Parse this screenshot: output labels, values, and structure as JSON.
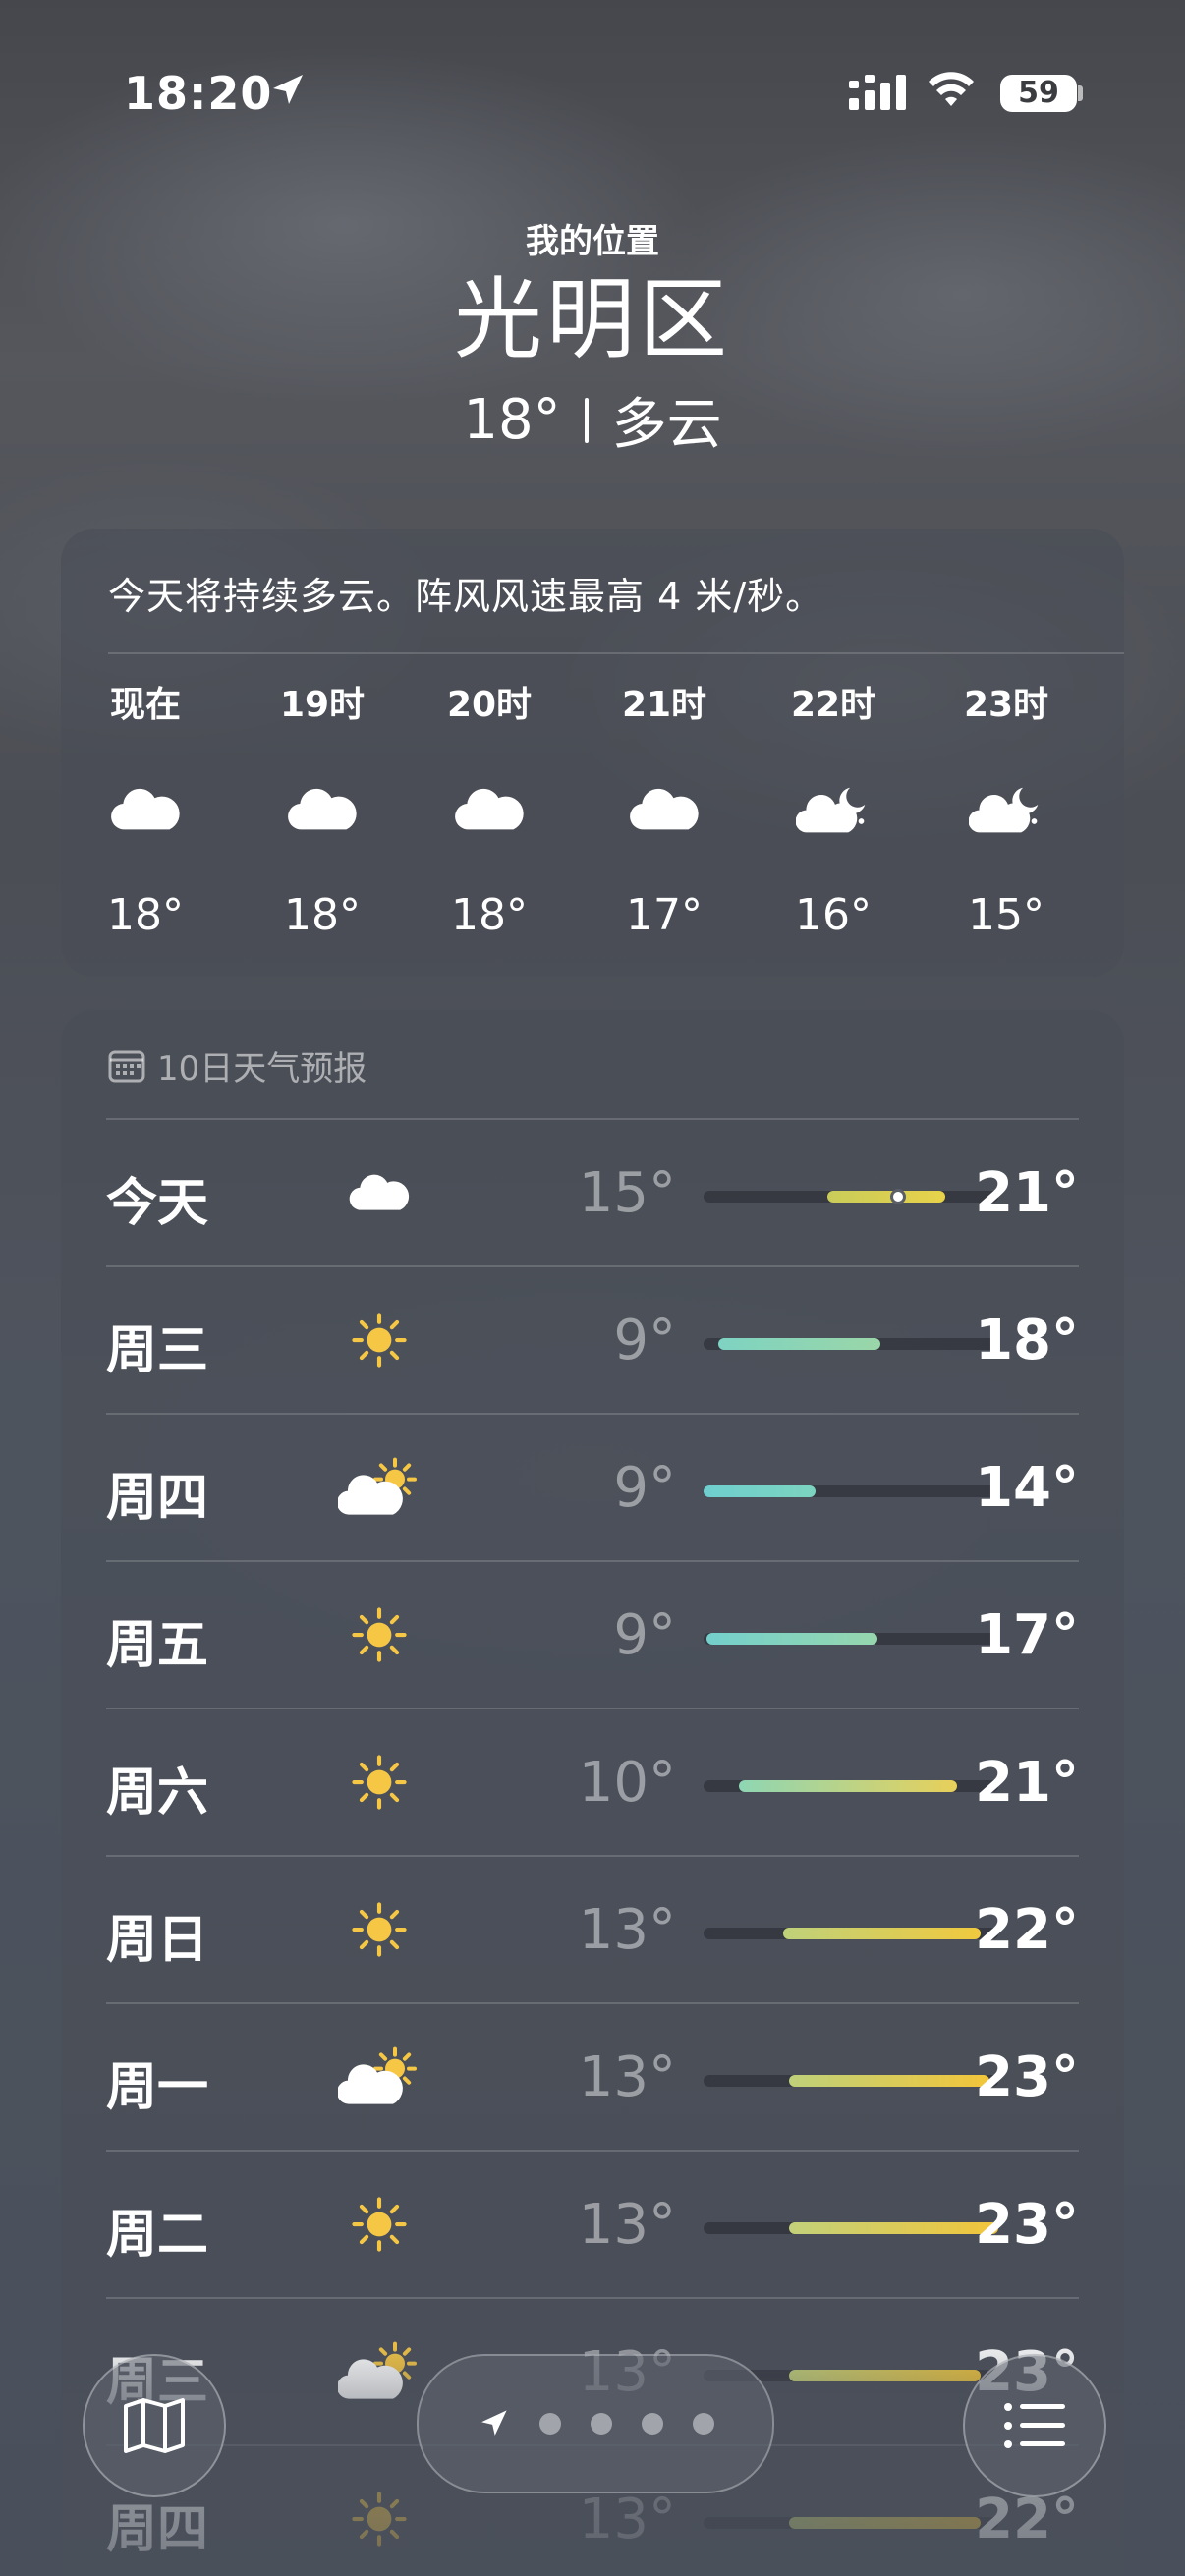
{
  "status_bar": {
    "time": "18:20",
    "battery": "59"
  },
  "header": {
    "my_location": "我的位置",
    "city": "光明区",
    "temperature": "18°",
    "condition": "多云"
  },
  "hourly": {
    "summary": "今天将持续多云。阵风风速最高 4 米/秒。",
    "items": [
      {
        "label": "现在",
        "icon": "cloud-icon",
        "temp": "18°"
      },
      {
        "label": "19时",
        "icon": "cloud-icon",
        "temp": "18°"
      },
      {
        "label": "20时",
        "icon": "cloud-icon",
        "temp": "18°"
      },
      {
        "label": "21时",
        "icon": "cloud-icon",
        "temp": "17°"
      },
      {
        "label": "22时",
        "icon": "cloud-moon-icon",
        "temp": "16°"
      },
      {
        "label": "23时",
        "icon": "cloud-moon-icon",
        "temp": "15°"
      }
    ]
  },
  "daily": {
    "title": "10日天气预报",
    "items": [
      {
        "day": "今天",
        "icon": "cloud-icon",
        "low": "15°",
        "high": "21°",
        "bar_start": 0.42,
        "bar_end": 0.82,
        "current": 0.66,
        "colors": [
          "#c9cc5a",
          "#e8d24a"
        ]
      },
      {
        "day": "周三",
        "icon": "sun-icon",
        "low": "9°",
        "high": "18°",
        "bar_start": 0.05,
        "bar_end": 0.6,
        "colors": [
          "#7ed3c2",
          "#9ad6a8"
        ]
      },
      {
        "day": "周四",
        "icon": "sun-cloud-icon",
        "low": "9°",
        "high": "14°",
        "bar_start": 0.0,
        "bar_end": 0.38,
        "colors": [
          "#6fcfcf",
          "#7cd4c0"
        ]
      },
      {
        "day": "周五",
        "icon": "sun-icon",
        "low": "9°",
        "high": "17°",
        "bar_start": 0.01,
        "bar_end": 0.59,
        "colors": [
          "#74d0cc",
          "#96d6ae"
        ]
      },
      {
        "day": "周六",
        "icon": "sun-icon",
        "low": "10°",
        "high": "21°",
        "bar_start": 0.12,
        "bar_end": 0.86,
        "colors": [
          "#8ed6b4",
          "#e8d05a"
        ]
      },
      {
        "day": "周日",
        "icon": "sun-icon",
        "low": "13°",
        "high": "22°",
        "bar_start": 0.27,
        "bar_end": 0.94,
        "colors": [
          "#bfd17a",
          "#f0c93e"
        ]
      },
      {
        "day": "周一",
        "icon": "sun-cloud-icon",
        "low": "13°",
        "high": "23°",
        "bar_start": 0.29,
        "bar_end": 0.97,
        "colors": [
          "#bfd17a",
          "#f2c53a"
        ]
      },
      {
        "day": "周二",
        "icon": "sun-icon",
        "low": "13°",
        "high": "23°",
        "bar_start": 0.29,
        "bar_end": 1.0,
        "colors": [
          "#c3d17a",
          "#f2c53a"
        ]
      },
      {
        "day": "周三",
        "icon": "sun-cloud-icon",
        "low": "13°",
        "high": "23°",
        "bar_start": 0.29,
        "bar_end": 0.94,
        "colors": [
          "#c3d17a",
          "#f2c53a"
        ]
      },
      {
        "day": "周四",
        "icon": "sun-icon",
        "low": "13°",
        "high": "22°",
        "bar_start": 0.29,
        "bar_end": 0.94,
        "colors": [
          "#c3d17a",
          "#f2c53a"
        ]
      }
    ]
  },
  "toolbar": {
    "map_icon": "map-icon",
    "location_icon": "location-arrow-icon",
    "list_icon": "list-icon",
    "page_count": 4
  }
}
